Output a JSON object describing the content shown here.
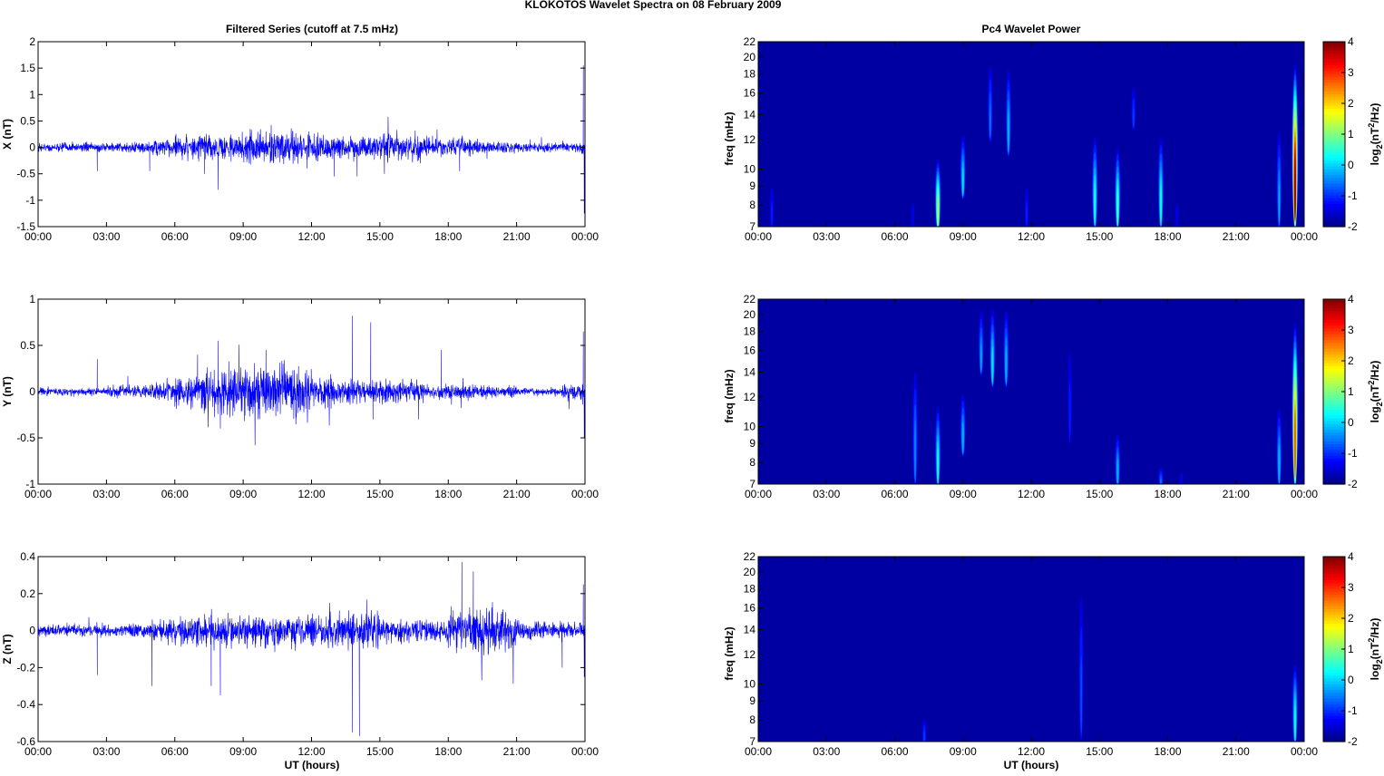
{
  "title": "KLOKOTOS Wavelet Spectra on 08 February  2009",
  "left_title": "Filtered Series (cutoff at 7.5 mHz)",
  "right_title": "Pc4 Wavelet Power",
  "xlabel": "UT (hours)",
  "xtick_labels": [
    "00:00",
    "03:00",
    "06:00",
    "09:00",
    "12:00",
    "15:00",
    "18:00",
    "21:00",
    "00:00"
  ],
  "colors": {
    "series": "#0000ff"
  },
  "chart_data": [
    {
      "type": "line",
      "component": "X",
      "ylabel": "X (nT)",
      "xlim": [
        0,
        24
      ],
      "ylim": [
        -1.5,
        2
      ],
      "yticks": [
        "-1.5",
        "-1",
        "-0.5",
        "0",
        "0.5",
        "1",
        "1.5",
        "2"
      ],
      "envelope_nT_per_hour": [
        0.04,
        0.04,
        0.04,
        0.04,
        0.05,
        0.08,
        0.1,
        0.12,
        0.12,
        0.14,
        0.16,
        0.14,
        0.12,
        0.1,
        0.1,
        0.12,
        0.1,
        0.08,
        0.08,
        0.06,
        0.05,
        0.04,
        0.04,
        0.05
      ],
      "spikes": [
        [
          2.6,
          -0.45
        ],
        [
          4.9,
          -0.45
        ],
        [
          7.3,
          -0.5
        ],
        [
          7.9,
          -0.8
        ],
        [
          10.0,
          0.3
        ],
        [
          11.8,
          -0.4
        ],
        [
          13.0,
          -0.55
        ],
        [
          14.0,
          -0.55
        ],
        [
          15.2,
          -0.5
        ],
        [
          18.5,
          -0.45
        ],
        [
          21.6,
          0.15
        ],
        [
          23.93,
          1.55
        ],
        [
          23.97,
          -1.25
        ]
      ]
    },
    {
      "type": "line",
      "component": "Y",
      "ylabel": "Y (nT)",
      "xlim": [
        0,
        24
      ],
      "ylim": [
        -1,
        1
      ],
      "yticks": [
        "-1",
        "-0.5",
        "0",
        "0.5",
        "1"
      ],
      "envelope_nT_per_hour": [
        0.02,
        0.02,
        0.02,
        0.03,
        0.03,
        0.05,
        0.08,
        0.1,
        0.12,
        0.13,
        0.15,
        0.13,
        0.08,
        0.06,
        0.06,
        0.06,
        0.05,
        0.04,
        0.04,
        0.03,
        0.03,
        0.02,
        0.02,
        0.04
      ],
      "spikes": [
        [
          2.6,
          0.35
        ],
        [
          7.0,
          0.4
        ],
        [
          7.9,
          0.55
        ],
        [
          8.0,
          -0.4
        ],
        [
          10.0,
          0.45
        ],
        [
          13.8,
          0.82
        ],
        [
          14.6,
          0.75
        ],
        [
          14.7,
          -0.3
        ],
        [
          16.7,
          -0.3
        ],
        [
          17.7,
          0.45
        ],
        [
          23.93,
          0.65
        ],
        [
          23.97,
          -0.5
        ]
      ]
    },
    {
      "type": "line",
      "component": "Z",
      "ylabel": "Z (nT)",
      "xlim": [
        0,
        24
      ],
      "ylim": [
        -0.6,
        0.4
      ],
      "yticks": [
        "-0.6",
        "-0.4",
        "-0.2",
        "0",
        "0.2",
        "0.4"
      ],
      "envelope_nT_per_hour": [
        0.015,
        0.015,
        0.015,
        0.015,
        0.02,
        0.03,
        0.04,
        0.045,
        0.04,
        0.04,
        0.04,
        0.04,
        0.04,
        0.045,
        0.045,
        0.035,
        0.03,
        0.03,
        0.06,
        0.07,
        0.05,
        0.025,
        0.02,
        0.02
      ],
      "spikes": [
        [
          2.6,
          -0.24
        ],
        [
          5.0,
          -0.3
        ],
        [
          7.6,
          -0.3
        ],
        [
          8.0,
          -0.35
        ],
        [
          12.8,
          0.15
        ],
        [
          13.8,
          -0.55
        ],
        [
          14.1,
          -0.57
        ],
        [
          18.6,
          0.37
        ],
        [
          19.1,
          0.32
        ],
        [
          23.0,
          -0.2
        ],
        [
          23.93,
          0.25
        ],
        [
          23.97,
          -0.25
        ]
      ]
    },
    {
      "type": "heatmap",
      "component": "X",
      "ylabel": "freq (mHz)",
      "xlim": [
        0,
        24
      ],
      "ylim": [
        7,
        22
      ],
      "yscale": "log",
      "yticks": [
        7,
        8,
        9,
        10,
        12,
        14,
        16,
        18,
        20,
        22
      ],
      "clim": [
        -2,
        4
      ],
      "cticks": [
        "-2",
        "-1",
        "0",
        "1",
        "2",
        "3",
        "4"
      ],
      "background_power": -1.8,
      "colorbar_label": [
        "log",
        "2",
        "(nT",
        "2",
        "/Hz)"
      ],
      "bursts": [
        [
          0.6,
          7,
          10,
          -1
        ],
        [
          6.8,
          7,
          9,
          -1.2
        ],
        [
          7.9,
          7,
          11,
          1.5
        ],
        [
          9.0,
          8.5,
          13,
          0.2
        ],
        [
          10.2,
          12,
          21,
          -0.5
        ],
        [
          11.0,
          11,
          20,
          0
        ],
        [
          11.8,
          7,
          10,
          -1
        ],
        [
          14.8,
          7,
          13,
          0.6
        ],
        [
          15.8,
          7,
          12,
          0.8
        ],
        [
          16.5,
          13,
          18,
          -0.8
        ],
        [
          17.7,
          7,
          13,
          0.5
        ],
        [
          18.4,
          7,
          9,
          -1.2
        ],
        [
          22.9,
          7,
          14,
          -0.2
        ],
        [
          23.6,
          7,
          20,
          4
        ]
      ]
    },
    {
      "type": "heatmap",
      "component": "Y",
      "ylabel": "freq (mHz)",
      "xlim": [
        0,
        24
      ],
      "ylim": [
        7,
        22
      ],
      "yscale": "log",
      "yticks": [
        7,
        8,
        9,
        10,
        12,
        14,
        16,
        18,
        20,
        22
      ],
      "clim": [
        -2,
        4
      ],
      "cticks": [
        "-2",
        "-1",
        "0",
        "1",
        "2",
        "3",
        "4"
      ],
      "background_power": -1.8,
      "colorbar_label": [
        "log",
        "2",
        "(nT",
        "2",
        "/Hz)"
      ],
      "bursts": [
        [
          6.9,
          7,
          16,
          -0.3
        ],
        [
          7.9,
          7,
          12,
          0.5
        ],
        [
          9.0,
          8.5,
          13,
          0
        ],
        [
          9.8,
          14,
          22,
          -0.2
        ],
        [
          10.3,
          13,
          22,
          0.3
        ],
        [
          10.9,
          13,
          22,
          0
        ],
        [
          13.7,
          9,
          20,
          -1
        ],
        [
          15.8,
          7,
          10,
          0
        ],
        [
          17.7,
          7,
          8,
          -0.5
        ],
        [
          18.6,
          7,
          8,
          -1.2
        ],
        [
          22.9,
          7,
          12,
          0
        ],
        [
          23.6,
          7,
          20,
          3
        ]
      ]
    },
    {
      "type": "heatmap",
      "component": "Z",
      "ylabel": "freq (mHz)",
      "xlim": [
        0,
        24
      ],
      "ylim": [
        7,
        22
      ],
      "yscale": "log",
      "yticks": [
        7,
        8,
        9,
        10,
        12,
        14,
        16,
        18,
        20,
        22
      ],
      "clim": [
        -2,
        4
      ],
      "cticks": [
        "-2",
        "-1",
        "0",
        "1",
        "2",
        "3",
        "4"
      ],
      "background_power": -1.8,
      "colorbar_label": [
        "log",
        "2",
        "(nT",
        "2",
        "/Hz)"
      ],
      "bursts": [
        [
          7.3,
          7,
          8.5,
          -0.8
        ],
        [
          14.2,
          7,
          22,
          -0.7
        ],
        [
          23.6,
          7,
          12,
          0.5
        ]
      ]
    }
  ]
}
